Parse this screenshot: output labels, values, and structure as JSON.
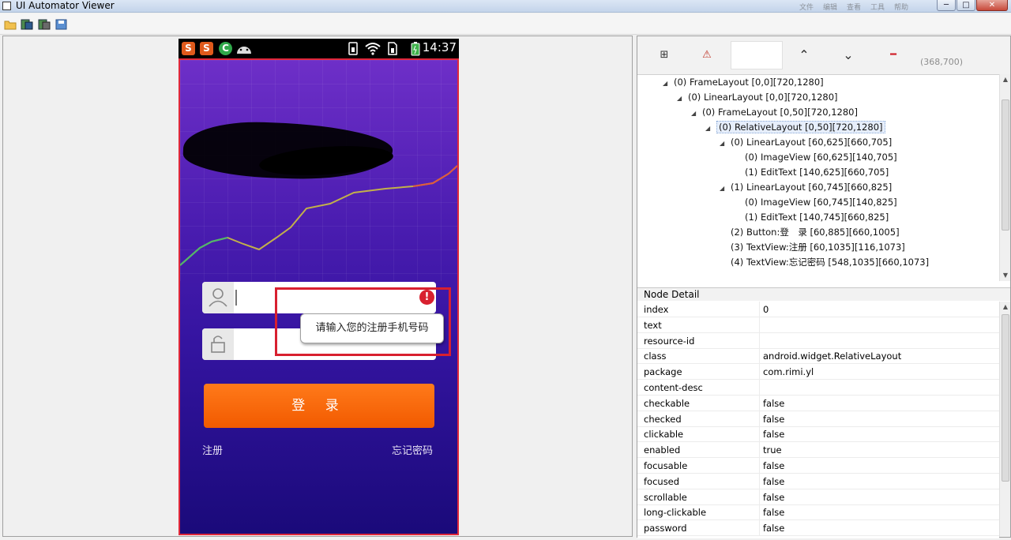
{
  "window": {
    "title": "UI Automator Viewer",
    "minimize": "─",
    "maximize": "□",
    "close": "✕",
    "faded_menu": [
      "文件",
      "编辑",
      "查看",
      "工具",
      "帮助"
    ]
  },
  "toolbar": {
    "items": [
      "open-folder-icon",
      "device-screenshot-icon",
      "device-screenshot-compressed-icon",
      "save-icon"
    ]
  },
  "phone": {
    "status_time": "14:37",
    "status_icons": [
      "S",
      "S",
      "C",
      "android"
    ],
    "username_placeholder": "",
    "password_placeholder": "",
    "error_tip": "请输入您的注册手机号码",
    "login_label": "登 录",
    "register_link": "注册",
    "forgot_link": "忘记密码"
  },
  "right_toolbar": {
    "expand": "⊞",
    "warning": "⚠",
    "up": "⌃",
    "down": "⌄",
    "collapse": "━",
    "coord": "(368,700)"
  },
  "tree": [
    {
      "depth": 0,
      "toggle": "◢",
      "label": "(0) FrameLayout [0,0][720,1280]"
    },
    {
      "depth": 1,
      "toggle": "◢",
      "label": "(0) LinearLayout [0,0][720,1280]"
    },
    {
      "depth": 2,
      "toggle": "◢",
      "label": "(0) FrameLayout [0,50][720,1280]"
    },
    {
      "depth": 3,
      "toggle": "◢",
      "label": "(0) RelativeLayout [0,50][720,1280]",
      "selected": true
    },
    {
      "depth": 4,
      "toggle": "◢",
      "label": "(0) LinearLayout [60,625][660,705]"
    },
    {
      "depth": 5,
      "toggle": "",
      "label": "(0) ImageView [60,625][140,705]"
    },
    {
      "depth": 5,
      "toggle": "",
      "label": "(1) EditText [140,625][660,705]"
    },
    {
      "depth": 4,
      "toggle": "◢",
      "label": "(1) LinearLayout [60,745][660,825]"
    },
    {
      "depth": 5,
      "toggle": "",
      "label": "(0) ImageView [60,745][140,825]"
    },
    {
      "depth": 5,
      "toggle": "",
      "label": "(1) EditText [140,745][660,825]"
    },
    {
      "depth": 4,
      "toggle": "",
      "label": "(2) Button:登　录 [60,885][660,1005]"
    },
    {
      "depth": 4,
      "toggle": "",
      "label": "(3) TextView:注册 [60,1035][116,1073]"
    },
    {
      "depth": 4,
      "toggle": "",
      "label": "(4) TextView:忘记密码 [548,1035][660,1073]"
    }
  ],
  "detail": {
    "header": "Node Detail",
    "rows": [
      {
        "key": "index",
        "value": "0"
      },
      {
        "key": "text",
        "value": ""
      },
      {
        "key": "resource-id",
        "value": ""
      },
      {
        "key": "class",
        "value": "android.widget.RelativeLayout"
      },
      {
        "key": "package",
        "value": "com.rimi.yl"
      },
      {
        "key": "content-desc",
        "value": ""
      },
      {
        "key": "checkable",
        "value": "false"
      },
      {
        "key": "checked",
        "value": "false"
      },
      {
        "key": "clickable",
        "value": "false"
      },
      {
        "key": "enabled",
        "value": "true"
      },
      {
        "key": "focusable",
        "value": "false"
      },
      {
        "key": "focused",
        "value": "false"
      },
      {
        "key": "scrollable",
        "value": "false"
      },
      {
        "key": "long-clickable",
        "value": "false"
      },
      {
        "key": "password",
        "value": "false"
      }
    ]
  }
}
